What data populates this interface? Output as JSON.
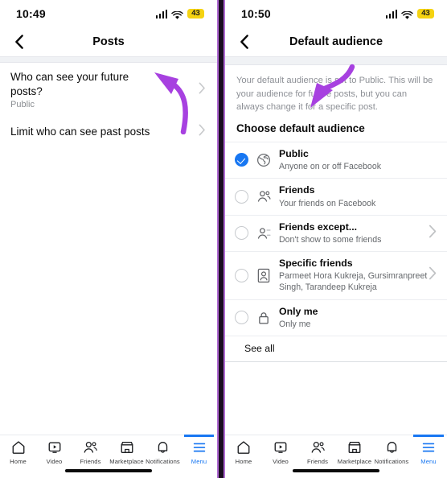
{
  "accent": "#1877f2",
  "annotation_color": "#a741e0",
  "battery_color": "#f5d311",
  "left": {
    "status": {
      "time": "10:49",
      "battery": "43",
      "signal_icon": "cellular-bars-icon",
      "wifi_icon": "wifi-icon"
    },
    "header": {
      "back_icon": "back-chevron-icon",
      "title": "Posts"
    },
    "rows": [
      {
        "title": "Who can see your future posts?",
        "subtitle": "Public",
        "chevron_icon": "chevron-right-icon"
      },
      {
        "title": "Limit who can see past posts",
        "subtitle": "",
        "chevron_icon": "chevron-right-icon"
      }
    ],
    "annotation": {
      "name": "purple-curved-arrow-up-left"
    }
  },
  "right": {
    "status": {
      "time": "10:50",
      "battery": "43",
      "signal_icon": "cellular-bars-icon",
      "wifi_icon": "wifi-icon"
    },
    "header": {
      "back_icon": "back-chevron-icon",
      "title": "Default audience"
    },
    "description": "Your default audience is set to Public. This will be your audience for future posts, but you can always change it for a specific post.",
    "section_title": "Choose default audience",
    "options": [
      {
        "label": "Public",
        "sublabel": "Anyone on or off Facebook",
        "icon": "globe-icon",
        "selected": true,
        "has_chevron": false
      },
      {
        "label": "Friends",
        "sublabel": "Your friends on Facebook",
        "icon": "friends-icon",
        "selected": false,
        "has_chevron": false
      },
      {
        "label": "Friends except...",
        "sublabel": "Don't show to some friends",
        "icon": "friends-except-icon",
        "selected": false,
        "has_chevron": true
      },
      {
        "label": "Specific friends",
        "sublabel": "Parmeet Hora Kukreja, Gursimranpreet Singh, Tarandeep Kukreja",
        "icon": "person-badge-icon",
        "selected": false,
        "has_chevron": true
      },
      {
        "label": "Only me",
        "sublabel": "Only me",
        "icon": "lock-icon",
        "selected": false,
        "has_chevron": false
      }
    ],
    "see_all": "See all",
    "annotation": {
      "name": "purple-curved-arrow-down-left"
    }
  },
  "tabbar": {
    "tabs": [
      {
        "label": "Home",
        "icon": "home-icon",
        "active": false
      },
      {
        "label": "Video",
        "icon": "video-icon",
        "active": false
      },
      {
        "label": "Friends",
        "icon": "friends-icon",
        "active": false
      },
      {
        "label": "Marketplace",
        "icon": "marketplace-icon",
        "active": false
      },
      {
        "label": "Notifications",
        "icon": "bell-icon",
        "active": false
      },
      {
        "label": "Menu",
        "icon": "hamburger-menu-icon",
        "active": true
      }
    ]
  }
}
